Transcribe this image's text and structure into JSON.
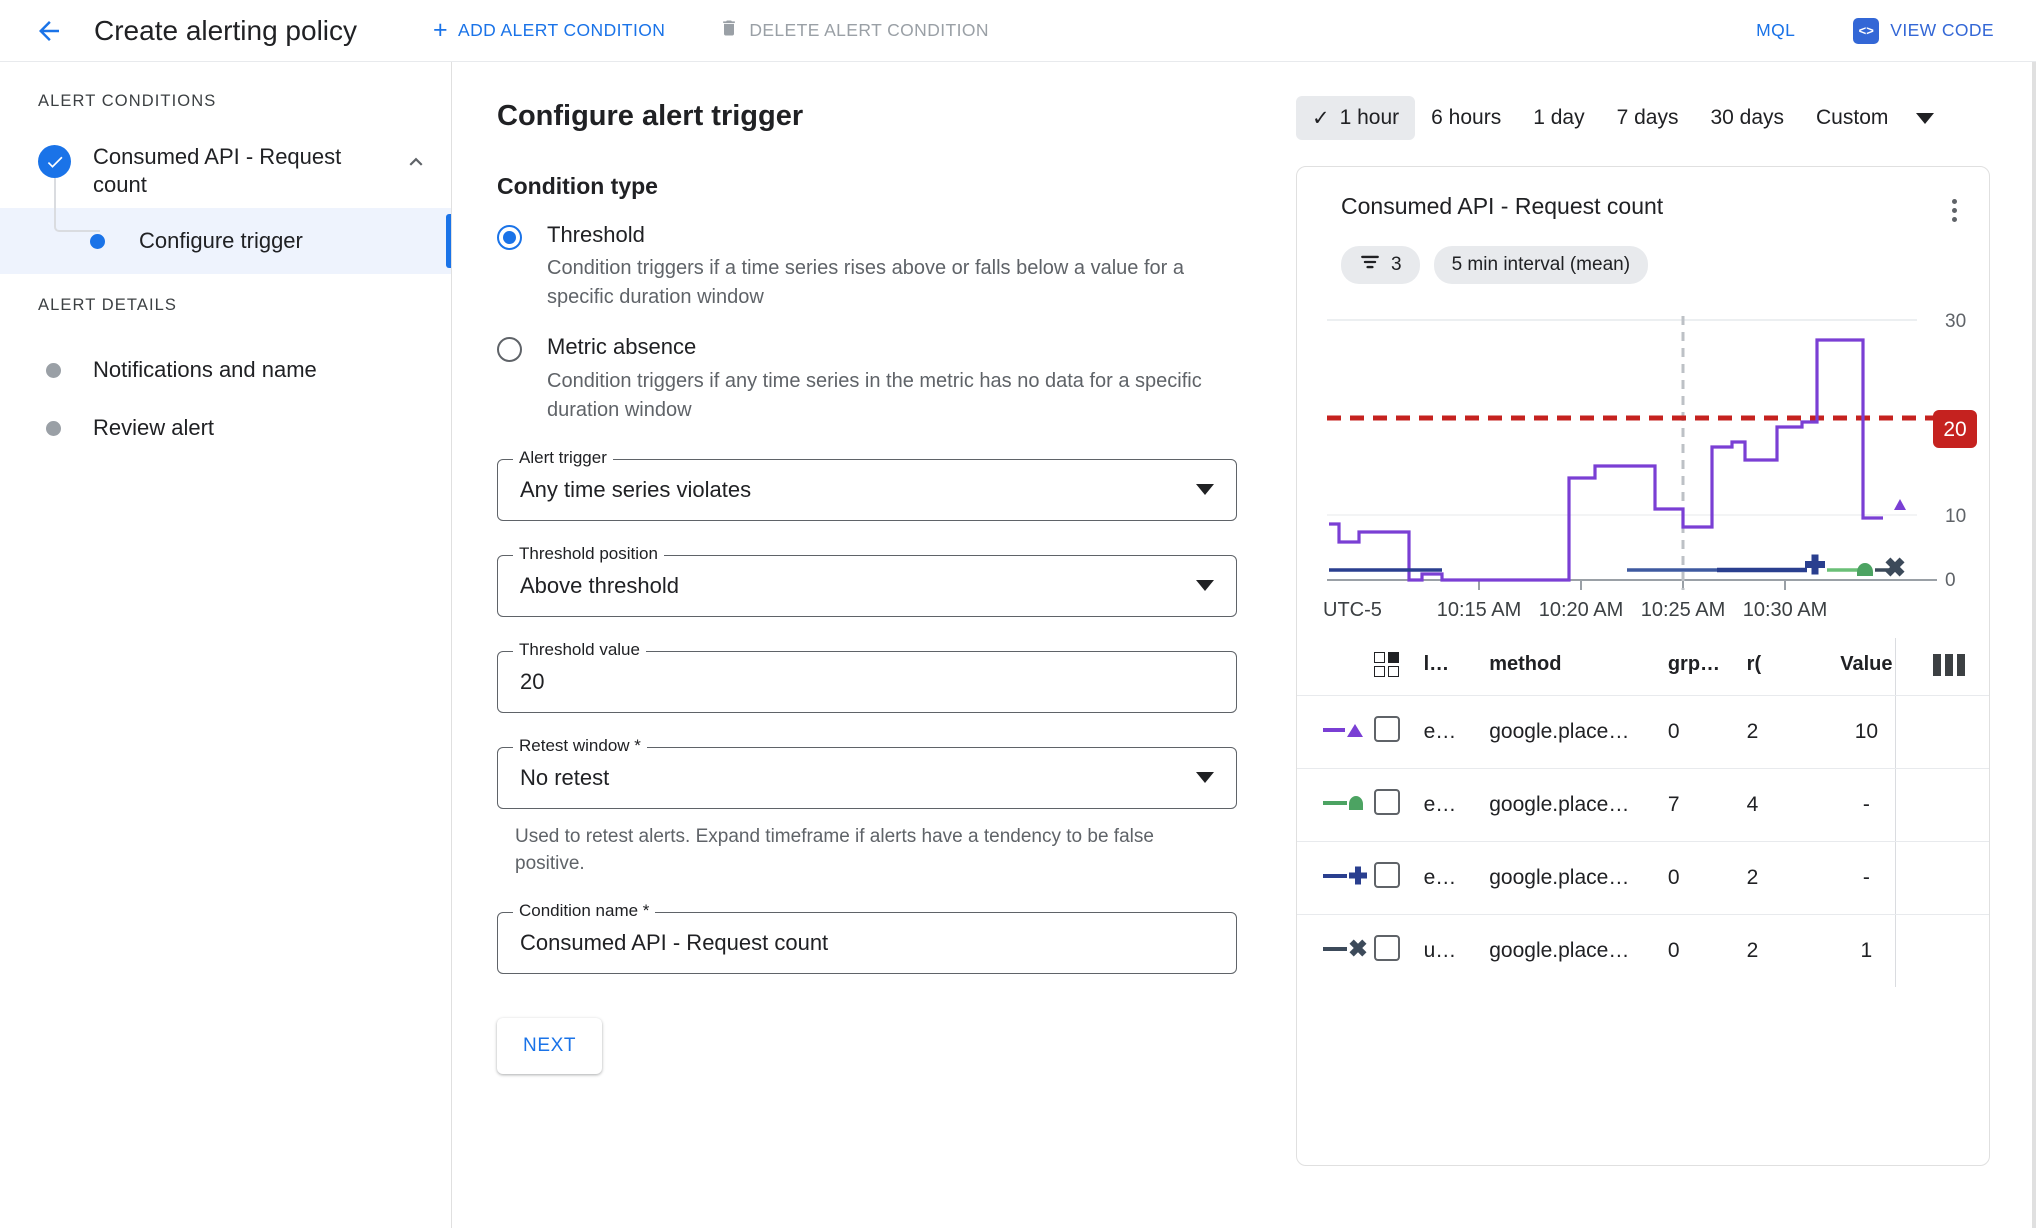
{
  "appbar": {
    "back_icon": "arrow-left-icon",
    "title": "Create alerting policy",
    "add_condition": "ADD ALERT CONDITION",
    "delete_condition": "DELETE ALERT CONDITION",
    "mql": "MQL",
    "view_code": "VIEW CODE",
    "code_glyph": "<>",
    "accent_blue": "#1a73e8",
    "disabled_grey": "#9aa0a6"
  },
  "sidebar": {
    "section_conditions": "ALERT CONDITIONS",
    "section_details": "ALERT DETAILS",
    "condition": {
      "label": "Consumed API - Request count",
      "state": "complete"
    },
    "sub_step": "Configure trigger",
    "details": [
      {
        "label": "Notifications and name"
      },
      {
        "label": "Review alert"
      }
    ]
  },
  "main": {
    "heading": "Configure alert trigger",
    "condition_type_heading": "Condition type",
    "options": [
      {
        "label": "Threshold",
        "description": "Condition triggers if a time series rises above or falls below a value for a specific duration window",
        "selected": true
      },
      {
        "label": "Metric absence",
        "description": "Condition triggers if any time series in the metric has no data for a specific duration window",
        "selected": false
      }
    ],
    "fields": [
      {
        "legend": "Alert trigger",
        "value": "Any time series violates",
        "type": "select"
      },
      {
        "legend": "Threshold position",
        "value": "Above threshold",
        "type": "select"
      },
      {
        "legend": "Threshold value",
        "value": "20",
        "type": "text"
      },
      {
        "legend": "Retest window *",
        "value": "No retest",
        "type": "select"
      },
      {
        "legend": "Condition name *",
        "value": "Consumed API - Request count",
        "type": "text"
      }
    ],
    "retest_helper": "Used to retest alerts. Expand timeframe if alerts have a tendency to be false positive.",
    "next_label": "NEXT"
  },
  "preview": {
    "ranges": [
      {
        "label": "1 hour",
        "active": true
      },
      {
        "label": "6 hours",
        "active": false
      },
      {
        "label": "1 day",
        "active": false
      },
      {
        "label": "7 days",
        "active": false
      },
      {
        "label": "30 days",
        "active": false
      },
      {
        "label": "Custom",
        "active": false
      }
    ],
    "card": {
      "title": "Consumed API - Request count",
      "menu_icon": "more-vert-icon",
      "chips": [
        {
          "icon": "filter-icon",
          "label": "3"
        },
        {
          "icon": "",
          "label": "5 min interval (mean)"
        }
      ]
    },
    "table": {
      "headers": [
        "",
        "",
        "l…",
        "method",
        "grp…",
        "r(",
        "Value",
        ""
      ],
      "rows": [
        {
          "marker_color": "#7A3FD4",
          "marker_shape": "triangle",
          "checked": false,
          "l": "e…",
          "method": "google.place…",
          "grp": "0",
          "r": "2",
          "value": "10"
        },
        {
          "marker_color": "#4CA362",
          "marker_shape": "bullet",
          "checked": false,
          "l": "e…",
          "method": "google.place…",
          "grp": "7",
          "r": "4",
          "value": "-"
        },
        {
          "marker_color": "#2A3F8F",
          "marker_shape": "plus",
          "checked": false,
          "l": "e…",
          "method": "google.place…",
          "grp": "0",
          "r": "2",
          "value": "-"
        },
        {
          "marker_color": "#3C4A5A",
          "marker_shape": "cross",
          "checked": false,
          "l": "u…",
          "method": "google.place…",
          "grp": "0",
          "r": "2",
          "value": "1"
        }
      ]
    }
  },
  "chart_data": {
    "type": "line",
    "title": "Consumed API - Request count",
    "xlabel": "",
    "ylabel": "",
    "timezone_label": "UTC-5",
    "xtick_labels": [
      "10:15 AM",
      "10:20 AM",
      "10:25 AM",
      "10:30 AM"
    ],
    "ytick_labels": [
      "0",
      "10",
      "20",
      "30"
    ],
    "ylim": [
      0,
      30
    ],
    "grid": true,
    "legend_position": "none",
    "threshold": {
      "value": 20,
      "label": "20",
      "color": "#c5221f",
      "style": "dashed"
    },
    "cursor_line": {
      "label": "10:25 AM",
      "color": "#bdc1c6",
      "style": "dashed"
    },
    "series": [
      {
        "name": "e… google.place… (triangle)",
        "color": "#7A3FD4",
        "marker": "triangle",
        "end_value": 10,
        "x": [
          0,
          2,
          4,
          6,
          10,
          14,
          17,
          20,
          22,
          25,
          28,
          31,
          34,
          37,
          40,
          43,
          45,
          47,
          50,
          53,
          56,
          59,
          62,
          65,
          68,
          71,
          74,
          77,
          80,
          84,
          88,
          92,
          96,
          100
        ],
        "values": [
          9,
          9,
          7,
          7,
          8,
          8,
          8,
          8,
          3,
          2.6,
          2.2,
          1.4,
          1.1,
          1.1,
          1.1,
          1.1,
          1.1,
          11,
          11,
          12.5,
          12.5,
          12.5,
          10,
          10,
          6.5,
          6.5,
          15,
          15,
          14,
          14,
          14,
          18.5,
          18.5,
          26,
          26,
          10
        ]
      },
      {
        "name": "e… google.place… (bullet)",
        "color": "#4CA362",
        "marker": "bullet",
        "end_value": 0,
        "values": [
          0,
          0,
          0,
          0,
          0
        ]
      },
      {
        "name": "e… google.place… (plus)",
        "color": "#2A3F8F",
        "marker": "plus",
        "end_value": 0,
        "values": [
          0,
          0,
          0,
          0,
          0
        ]
      },
      {
        "name": "u… google.place… (cross)",
        "color": "#3C4A5A",
        "marker": "cross",
        "end_value": 0,
        "values": [
          0,
          0,
          0,
          0,
          0
        ]
      }
    ]
  }
}
